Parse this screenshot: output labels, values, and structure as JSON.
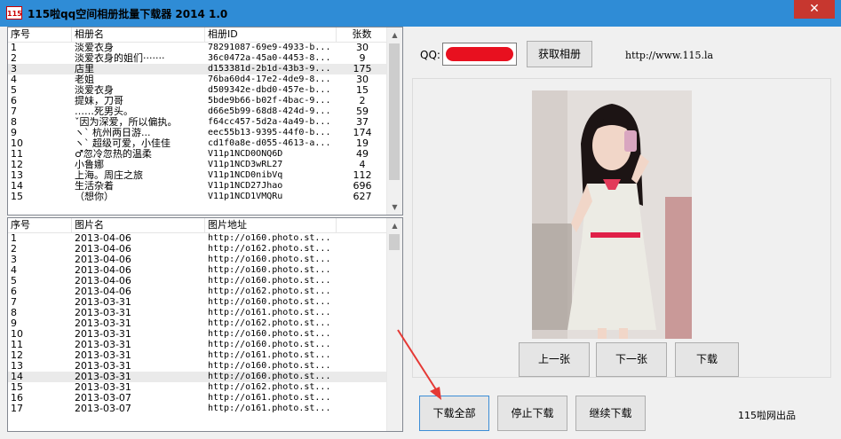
{
  "window": {
    "title": "115啦qq空间相册批量下载器 2014 1.0",
    "icon_text": "115",
    "close_glyph": "✕"
  },
  "albums": {
    "columns": [
      "序号",
      "相册名",
      "相册ID",
      "张数"
    ],
    "rows": [
      [
        "1",
        "淡爱衣身",
        "78291087-69e9-4933-b...",
        "30"
      ],
      [
        "2",
        "淡爱衣身的姐们·······",
        "36c0472a-45a0-4453-8...",
        "9"
      ],
      [
        "3",
        "店里",
        "d153381d-2b1d-43b3-9...",
        "175"
      ],
      [
        "4",
        "老姐",
        "76ba60d4-17e2-4de9-8...",
        "30"
      ],
      [
        "5",
        "淡爱衣身",
        "d509342e-dbd0-457e-b...",
        "15"
      ],
      [
        "6",
        "提妹，刀哥",
        "5bde9b66-b02f-4bac-9...",
        "2"
      ],
      [
        "7",
        "……死男头。",
        "d66e5b99-68d8-424d-9...",
        "59"
      ],
      [
        "8",
        "ˇ因为深爱，所以偏执。",
        "f64cc457-5d2a-4a49-b...",
        "37"
      ],
      [
        "9",
        "ヽ` 杭州两日游...",
        "eec55b13-9395-44f0-b...",
        "174"
      ],
      [
        "10",
        "ヽ` 超级可爱，小佳佳",
        "cd1f0a8e-d055-4613-a...",
        "19"
      ],
      [
        "11",
        "♂忽冷忽热的温柔",
        "V11p1NCD0ONQ6D",
        "49"
      ],
      [
        "12",
        "小鲁娜",
        "V11p1NCD3wRL27",
        "4"
      ],
      [
        "13",
        "上海。周庄之旅",
        "V11p1NCD0nibVq",
        "112"
      ],
      [
        "14",
        "生活杂着",
        "V11p1NCD27Jhao",
        "696"
      ],
      [
        "15",
        "（想你）",
        "V11p1NCD1VMQRu",
        "627"
      ]
    ]
  },
  "photos": {
    "columns": [
      "序号",
      "图片名",
      "图片地址"
    ],
    "rows": [
      [
        "1",
        "2013-04-06",
        "http://o160.photo.st..."
      ],
      [
        "2",
        "2013-04-06",
        "http://o162.photo.st..."
      ],
      [
        "3",
        "2013-04-06",
        "http://o160.photo.st..."
      ],
      [
        "4",
        "2013-04-06",
        "http://o160.photo.st..."
      ],
      [
        "5",
        "2013-04-06",
        "http://o160.photo.st..."
      ],
      [
        "6",
        "2013-04-06",
        "http://o162.photo.st..."
      ],
      [
        "7",
        "2013-03-31",
        "http://o160.photo.st..."
      ],
      [
        "8",
        "2013-03-31",
        "http://o161.photo.st..."
      ],
      [
        "9",
        "2013-03-31",
        "http://o162.photo.st..."
      ],
      [
        "10",
        "2013-03-31",
        "http://o160.photo.st..."
      ],
      [
        "11",
        "2013-03-31",
        "http://o160.photo.st..."
      ],
      [
        "12",
        "2013-03-31",
        "http://o161.photo.st..."
      ],
      [
        "13",
        "2013-03-31",
        "http://o160.photo.st..."
      ],
      [
        "14",
        "2013-03-31",
        "http://o160.photo.st..."
      ],
      [
        "15",
        "2013-03-31",
        "http://o162.photo.st..."
      ],
      [
        "16",
        "2013-03-07",
        "http://o161.photo.st..."
      ],
      [
        "17",
        "2013-03-07",
        "http://o161.photo.st..."
      ]
    ]
  },
  "panel": {
    "qq_label": "QQ:",
    "get_albums": "获取相册",
    "url": "http://www.115.la",
    "prev": "上一张",
    "next": "下一张",
    "download": "下载",
    "download_all": "下载全部",
    "stop": "停止下载",
    "resume": "继续下载",
    "credit": "115啦网出品"
  },
  "colors": {
    "titlebar": "#2f8cd6",
    "close": "#c7372f",
    "redaction": "#e8101f",
    "arrow": "#e53935",
    "selection": "#eaeaea"
  }
}
